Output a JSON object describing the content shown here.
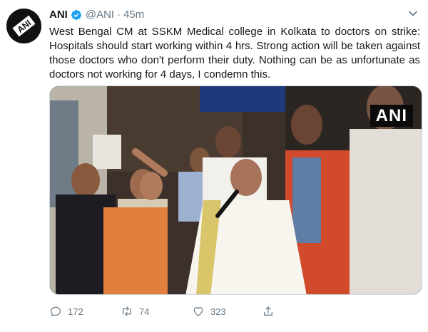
{
  "tweet": {
    "author_name": "ANI",
    "handle": "@ANI",
    "separator": "·",
    "time_ago": "45m",
    "text": "West Bengal CM at SSKM Medical college in Kolkata to doctors on strike: Hospitals should start working within 4 hrs. Strong action will be taken against those doctors who don't perform their duty. Nothing can be as unfortunate as doctors not working for 4 days, I condemn this.",
    "avatar_label": "ANI",
    "media_watermark": "ANI",
    "media_sign_text": "",
    "icons": {
      "verified": "verified-badge-icon",
      "caret": "chevron-down-icon",
      "reply": "reply-icon",
      "retweet": "retweet-icon",
      "like": "heart-icon",
      "share": "share-icon"
    }
  },
  "actions": {
    "reply_count": "172",
    "retweet_count": "74",
    "like_count": "323"
  },
  "colors": {
    "text": "#14171a",
    "secondary": "#657786",
    "verified": "#1da1f2",
    "border": "#ccd6dd"
  }
}
